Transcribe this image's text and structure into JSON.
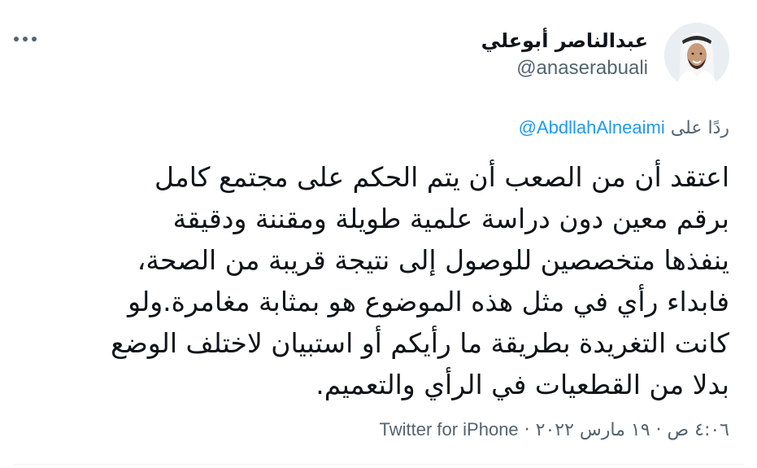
{
  "tweet": {
    "author": {
      "display_name": "عبدالناصر أبوعلي",
      "handle": "@anaserabuali",
      "avatar_icon": "user-avatar"
    },
    "reply": {
      "prefix": "ردًا على",
      "mention": "@AbdllahAlneaimi"
    },
    "text_lines": [
      "اعتقد أن من الصعب أن يتم الحكم على مجتمع كامل",
      "برقم معين دون دراسة علمية طويلة ومقننة ودقيقة",
      "ينفذها متخصصين للوصول إلى نتيجة قريبة من الصحة،",
      "فابداء رأي في مثل هذه الموضوع هو بمثابة مغامرة.ولو",
      "كانت التغريدة بطريقة ما رأيكم أو استبيان لاختلف الوضع",
      "بدلا من القطعيات في الرأي والتعميم."
    ],
    "meta": {
      "time": "٤:٠٦ ص",
      "date": "١٩ مارس ٢٠٢٢",
      "separator": "·",
      "source": "Twitter for iPhone"
    },
    "more_icon": "more-horizontal-icon"
  },
  "colors": {
    "text_primary": "#0f1419",
    "text_secondary": "#536471",
    "link": "#1d9bf0"
  }
}
